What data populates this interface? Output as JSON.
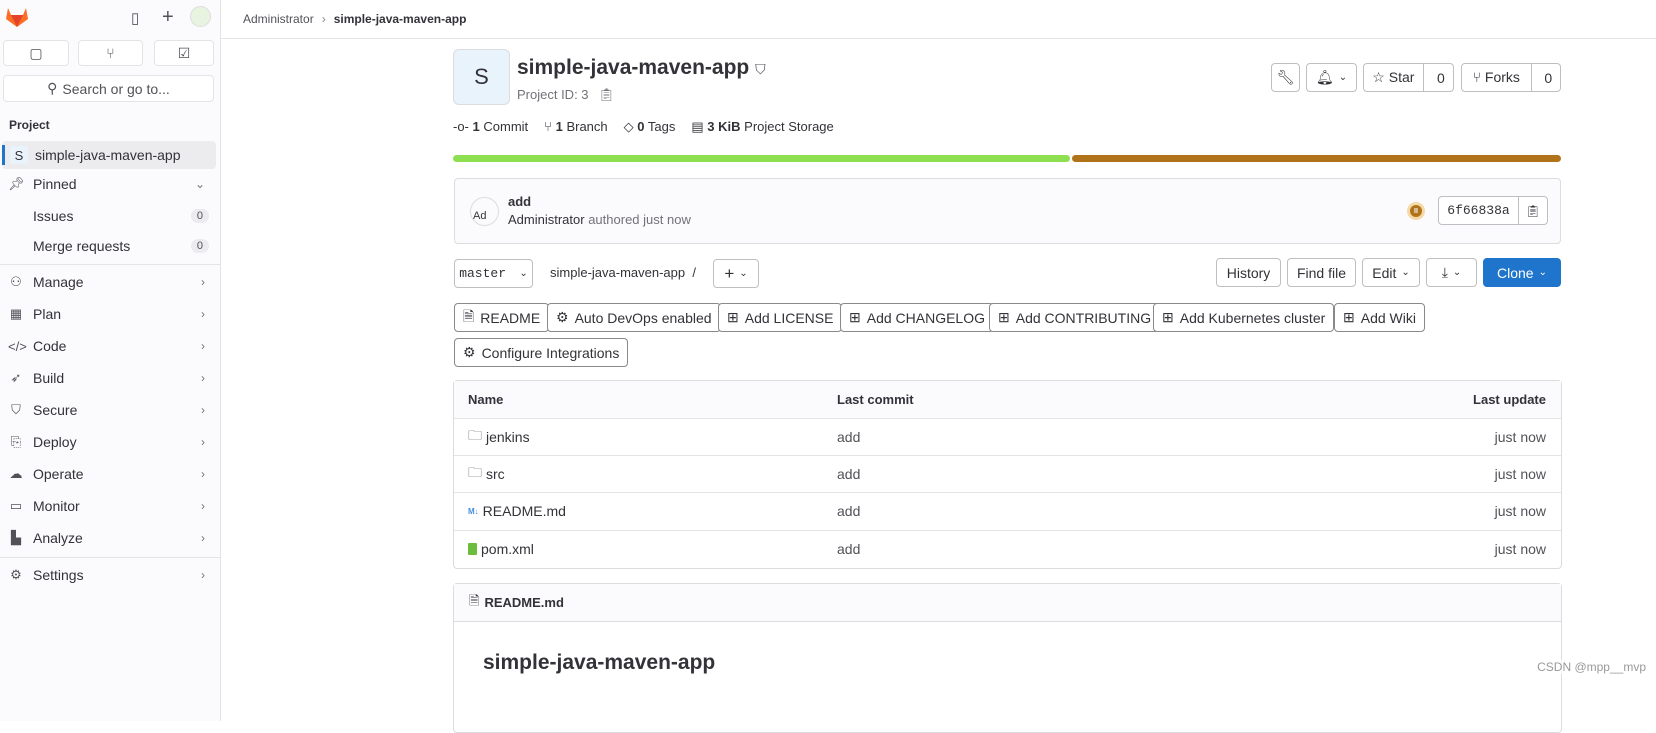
{
  "sidebar": {
    "search_placeholder": "Search or go to...",
    "section_label": "Project",
    "project": {
      "avatar_letter": "S",
      "name": "simple-java-maven-app"
    },
    "pinned": {
      "label": "Pinned",
      "items": [
        {
          "label": "Issues",
          "count": "0"
        },
        {
          "label": "Merge requests",
          "count": "0"
        }
      ]
    },
    "items": [
      {
        "label": "Manage"
      },
      {
        "label": "Plan"
      },
      {
        "label": "Code"
      },
      {
        "label": "Build"
      },
      {
        "label": "Secure"
      },
      {
        "label": "Deploy"
      },
      {
        "label": "Operate"
      },
      {
        "label": "Monitor"
      },
      {
        "label": "Analyze"
      }
    ],
    "settings": "Settings"
  },
  "breadcrumb": {
    "parent": "Administrator",
    "current": "simple-java-maven-app"
  },
  "project": {
    "avatar_letter": "S",
    "title": "simple-java-maven-app",
    "id_label": "Project ID: 3",
    "stats": {
      "commits_n": "1",
      "commits": "Commit",
      "branches_n": "1",
      "branches": "Branch",
      "tags_n": "0",
      "tags": "Tags",
      "storage_n": "3 KiB",
      "storage": "Project Storage"
    },
    "star_label": "Star",
    "star_count": "0",
    "forks_label": "Forks",
    "forks_count": "0"
  },
  "languages": [
    {
      "percent": 55.8,
      "color": "#8fe051"
    },
    {
      "percent": 44.2,
      "color": "#b0731a"
    }
  ],
  "last_commit": {
    "avatar_alt": "Ad",
    "message": "add",
    "author": "Administrator",
    "time": "authored just now",
    "sha": "6f66838a",
    "pipeline_status": "paused",
    "status_color": "#b0731a"
  },
  "repo_nav": {
    "branch": "master",
    "path": "simple-java-maven-app",
    "separator": "/",
    "add": "+",
    "history": "History",
    "find_file": "Find file",
    "edit": "Edit",
    "clone": "Clone"
  },
  "shortcuts": [
    "README",
    "Auto DevOps enabled",
    "Add LICENSE",
    "Add CHANGELOG",
    "Add CONTRIBUTING",
    "Add Kubernetes cluster",
    "Add Wiki",
    "Configure Integrations"
  ],
  "files": {
    "headers": {
      "name": "Name",
      "last_commit": "Last commit",
      "last_update": "Last update"
    },
    "rows": [
      {
        "name": "jenkins",
        "icon": "folder-icon",
        "commit": "add",
        "updated": "just now"
      },
      {
        "name": "src",
        "icon": "folder-icon",
        "commit": "add",
        "updated": "just now"
      },
      {
        "name": "README.md",
        "icon": "markdown-icon",
        "commit": "add",
        "updated": "just now"
      },
      {
        "name": "pom.xml",
        "icon": "xml-file-icon",
        "commit": "add",
        "updated": "just now"
      }
    ]
  },
  "readme": {
    "file": "README.md",
    "heading": "simple-java-maven-app"
  },
  "watermark": "CSDN @mpp__mvp"
}
